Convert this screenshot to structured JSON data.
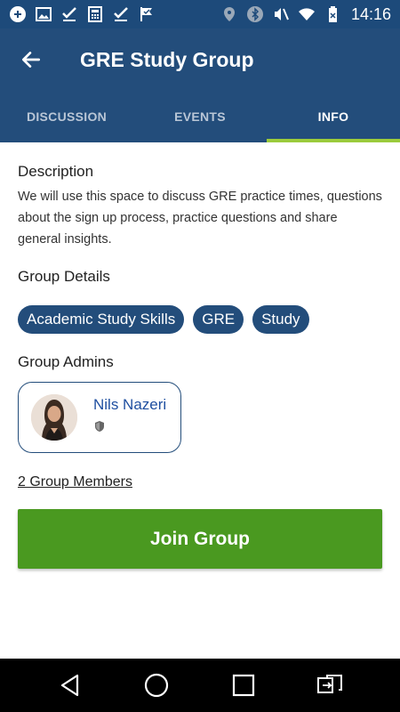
{
  "status_bar": {
    "time": "14:16",
    "left_icons": [
      "app-icon",
      "image-icon",
      "check-icon",
      "calculator-icon",
      "check-icon",
      "flag-check-icon"
    ],
    "right_icons": [
      "location-icon",
      "bluetooth-icon",
      "mute-icon",
      "wifi-icon",
      "battery-icon"
    ]
  },
  "app_bar": {
    "title": "GRE Study Group",
    "back_icon": "arrow-left-icon"
  },
  "tabs": [
    {
      "label": "DISCUSSION",
      "active": false
    },
    {
      "label": "EVENTS",
      "active": false
    },
    {
      "label": "INFO",
      "active": true
    }
  ],
  "description": {
    "title": "Description",
    "text": "We will use this space to discuss GRE practice times, questions about the sign up process, practice questions and share general insights."
  },
  "group_details": {
    "title": "Group Details",
    "tags": [
      "Academic Study Skills",
      "GRE",
      "Study"
    ]
  },
  "group_admins": {
    "title": "Group Admins",
    "admins": [
      {
        "name": "Nils Nazeri",
        "role_icon": "shield-icon"
      }
    ]
  },
  "members_link": "2 Group Members",
  "join_button": "Join Group",
  "colors": {
    "primary": "#234d7b",
    "status_bar": "#1d4a7a",
    "tab_indicator": "#9bcb3c",
    "join_button": "#4a9920",
    "admin_name": "#1f4fa0"
  },
  "nav_bar": [
    "back-triangle-icon",
    "home-circle-icon",
    "recents-square-icon",
    "switch-app-icon"
  ]
}
